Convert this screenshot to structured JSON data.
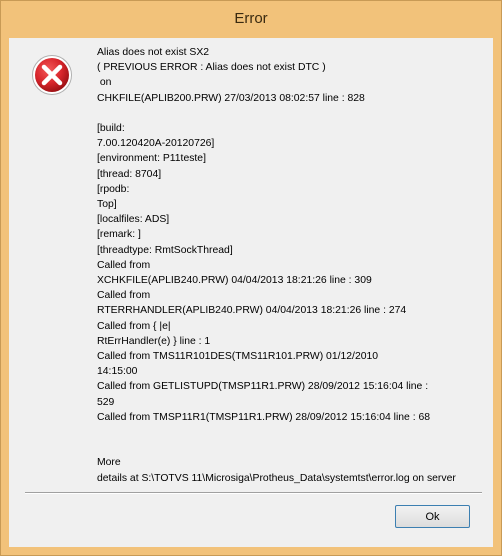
{
  "dialog": {
    "title": "Error",
    "message_lines": [
      "Alias does not exist SX2",
      "( PREVIOUS ERROR : Alias does not exist DTC )",
      " on",
      "CHKFILE(APLIB200.PRW) 27/03/2013 08:02:57 line : 828",
      "",
      "[build:",
      "7.00.120420A-20120726]",
      "[environment: P11teste]",
      "[thread: 8704]",
      "[rpodb:",
      "Top]",
      "[localfiles: ADS]",
      "[remark: ]",
      "[threadtype: RmtSockThread]",
      "Called from",
      "XCHKFILE(APLIB240.PRW) 04/04/2013 18:21:26 line : 309",
      "Called from",
      "RTERRHANDLER(APLIB240.PRW) 04/04/2013 18:21:26 line : 274",
      "Called from { |e|",
      "RtErrHandler(e) } line : 1",
      "Called from TMS11R101DES(TMS11R101.PRW) 01/12/2010",
      "14:15:00",
      "Called from GETLISTUPD(TMSP11R1.PRW) 28/09/2012 15:16:04 line :",
      "529",
      "Called from TMSP11R1(TMSP11R1.PRW) 28/09/2012 15:16:04 line : 68",
      "",
      "",
      "More",
      "details at S:\\TOTVS 11\\Microsiga\\Protheus_Data\\systemtst\\error.log on server"
    ],
    "ok_label": "Ok",
    "icon": "error-icon",
    "colors": {
      "titlebar": "#f2c27a",
      "icon_red": "#d8262c",
      "button_border": "#3c7fb1"
    }
  }
}
